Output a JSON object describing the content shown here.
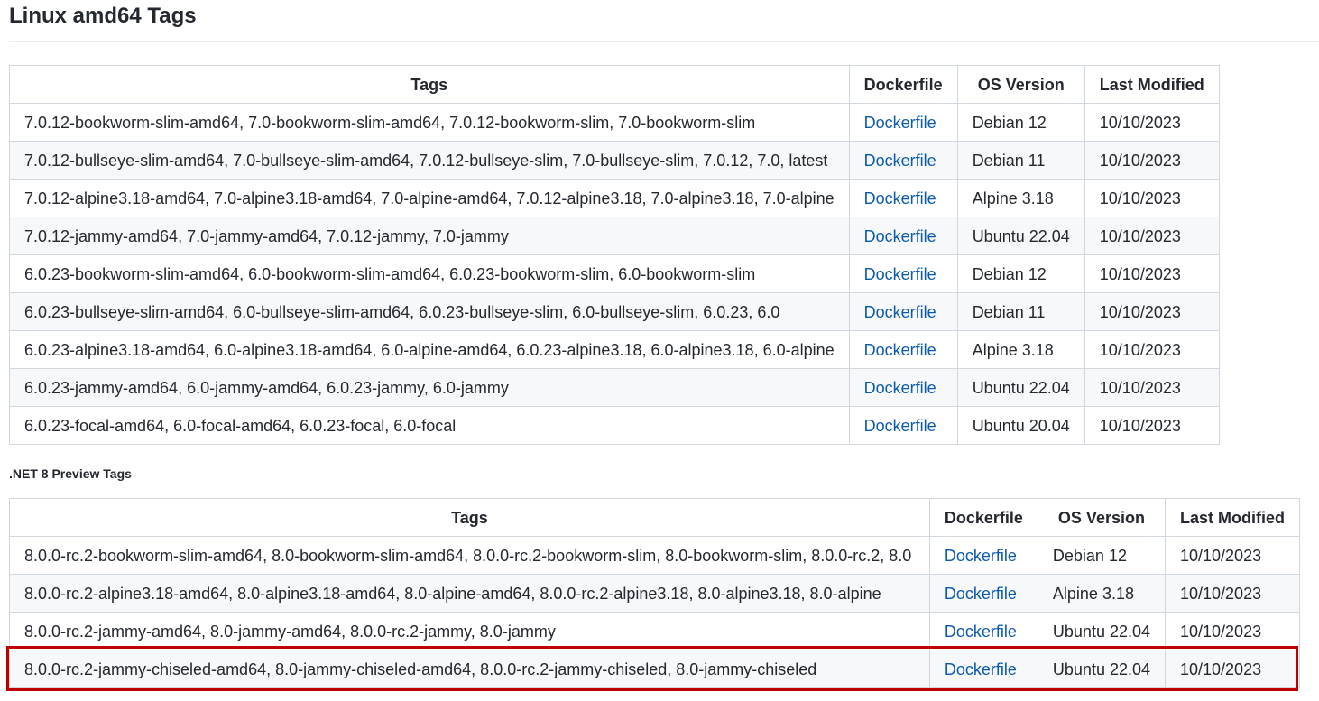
{
  "heading": "Linux amd64 Tags",
  "subheading": ".NET 8 Preview Tags",
  "columns": {
    "tags": "Tags",
    "dockerfile": "Dockerfile",
    "os_version": "OS Version",
    "last_modified": "Last Modified"
  },
  "linux_rows": [
    {
      "tags": "7.0.12-bookworm-slim-amd64, 7.0-bookworm-slim-amd64, 7.0.12-bookworm-slim, 7.0-bookworm-slim",
      "dockerfile": "Dockerfile",
      "os": "Debian 12",
      "modified": "10/10/2023"
    },
    {
      "tags": "7.0.12-bullseye-slim-amd64, 7.0-bullseye-slim-amd64, 7.0.12-bullseye-slim, 7.0-bullseye-slim, 7.0.12, 7.0, latest",
      "dockerfile": "Dockerfile",
      "os": "Debian 11",
      "modified": "10/10/2023"
    },
    {
      "tags": "7.0.12-alpine3.18-amd64, 7.0-alpine3.18-amd64, 7.0-alpine-amd64, 7.0.12-alpine3.18, 7.0-alpine3.18, 7.0-alpine",
      "dockerfile": "Dockerfile",
      "os": "Alpine 3.18",
      "modified": "10/10/2023"
    },
    {
      "tags": "7.0.12-jammy-amd64, 7.0-jammy-amd64, 7.0.12-jammy, 7.0-jammy",
      "dockerfile": "Dockerfile",
      "os": "Ubuntu 22.04",
      "modified": "10/10/2023"
    },
    {
      "tags": "6.0.23-bookworm-slim-amd64, 6.0-bookworm-slim-amd64, 6.0.23-bookworm-slim, 6.0-bookworm-slim",
      "dockerfile": "Dockerfile",
      "os": "Debian 12",
      "modified": "10/10/2023"
    },
    {
      "tags": "6.0.23-bullseye-slim-amd64, 6.0-bullseye-slim-amd64, 6.0.23-bullseye-slim, 6.0-bullseye-slim, 6.0.23, 6.0",
      "dockerfile": "Dockerfile",
      "os": "Debian 11",
      "modified": "10/10/2023"
    },
    {
      "tags": "6.0.23-alpine3.18-amd64, 6.0-alpine3.18-amd64, 6.0-alpine-amd64, 6.0.23-alpine3.18, 6.0-alpine3.18, 6.0-alpine",
      "dockerfile": "Dockerfile",
      "os": "Alpine 3.18",
      "modified": "10/10/2023"
    },
    {
      "tags": "6.0.23-jammy-amd64, 6.0-jammy-amd64, 6.0.23-jammy, 6.0-jammy",
      "dockerfile": "Dockerfile",
      "os": "Ubuntu 22.04",
      "modified": "10/10/2023"
    },
    {
      "tags": "6.0.23-focal-amd64, 6.0-focal-amd64, 6.0.23-focal, 6.0-focal",
      "dockerfile": "Dockerfile",
      "os": "Ubuntu 20.04",
      "modified": "10/10/2023"
    }
  ],
  "preview_rows": [
    {
      "tags": "8.0.0-rc.2-bookworm-slim-amd64, 8.0-bookworm-slim-amd64, 8.0.0-rc.2-bookworm-slim, 8.0-bookworm-slim, 8.0.0-rc.2, 8.0",
      "dockerfile": "Dockerfile",
      "os": "Debian 12",
      "modified": "10/10/2023"
    },
    {
      "tags": "8.0.0-rc.2-alpine3.18-amd64, 8.0-alpine3.18-amd64, 8.0-alpine-amd64, 8.0.0-rc.2-alpine3.18, 8.0-alpine3.18, 8.0-alpine",
      "dockerfile": "Dockerfile",
      "os": "Alpine 3.18",
      "modified": "10/10/2023"
    },
    {
      "tags": "8.0.0-rc.2-jammy-amd64, 8.0-jammy-amd64, 8.0.0-rc.2-jammy, 8.0-jammy",
      "dockerfile": "Dockerfile",
      "os": "Ubuntu 22.04",
      "modified": "10/10/2023"
    },
    {
      "tags": "8.0.0-rc.2-jammy-chiseled-amd64, 8.0-jammy-chiseled-amd64, 8.0.0-rc.2-jammy-chiseled, 8.0-jammy-chiseled",
      "dockerfile": "Dockerfile",
      "os": "Ubuntu 22.04",
      "modified": "10/10/2023"
    }
  ],
  "colors": {
    "link": "#0a5ab0",
    "highlight": "#c00000",
    "border": "#d0d7de",
    "stripe": "#f6f8fa"
  }
}
